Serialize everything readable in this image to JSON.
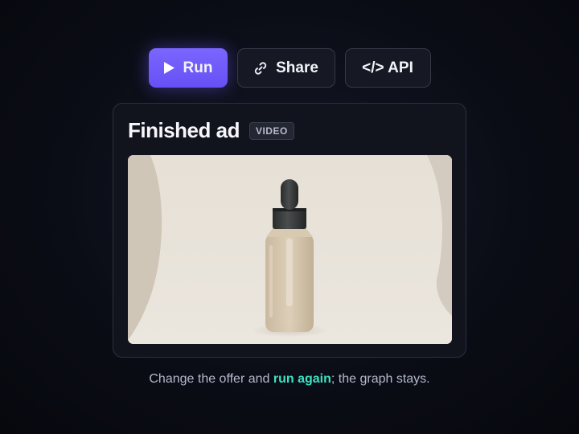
{
  "toolbar": {
    "run_label": "Run",
    "share_label": "Share",
    "api_label": "</> API"
  },
  "card": {
    "title": "Finished ad",
    "badge": "VIDEO"
  },
  "caption": {
    "before": "Change the offer and ",
    "highlight": "run again",
    "after": "; the graph stays."
  },
  "colors": {
    "accent": "#6f5bff",
    "highlight": "#39e3c3",
    "background": "#0b0d16"
  },
  "icons": {
    "run": "play-icon",
    "share": "link-icon"
  }
}
